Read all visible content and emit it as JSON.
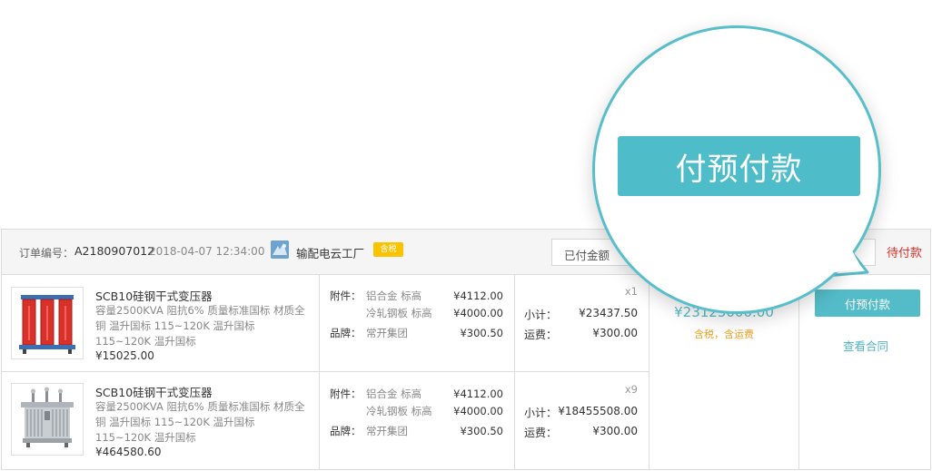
{
  "header": {
    "order_no_label": "订单编号：",
    "order_no": "A2180907012",
    "order_time": "2018-04-07 12:34:00",
    "shop_name": "输配电云工厂",
    "tax_badge": "含税",
    "paid_amount_label": "已付金额",
    "status": "待付款"
  },
  "items": [
    {
      "name": "SCB10硅钢干式变压器",
      "spec": "容量2500KVA  阻抗6%  质量标准国标  材质全铜  温升国标  115~120K  温升国标 115~120K 温升国标",
      "unit_price": "¥15025.00",
      "accessory_label": "附件：",
      "accessories": [
        {
          "name": "铝合金 标高",
          "price": "¥4112.00"
        },
        {
          "name": "冷轧钢板 标高",
          "price": "¥4000.00"
        }
      ],
      "brand_label": "品牌：",
      "brand": "常开集团",
      "brand_price": "¥300.50",
      "qty": "x1",
      "subtotal_label": "小计：",
      "subtotal": "¥23437.50",
      "freight_label": "运费：",
      "freight": "¥300.00",
      "thumb": "red-transformer-image"
    },
    {
      "name": "SCB10硅钢干式变压器",
      "spec": "容量2500KVA  阻抗6%  质量标准国标  材质全铜  温升国标  115~120K  温升国标 115~120K 温升国标",
      "unit_price": "¥464580.60",
      "accessory_label": "附件：",
      "accessories": [
        {
          "name": "铝合金 标高",
          "price": "¥4112.00"
        },
        {
          "name": "冷轧钢板 标高",
          "price": "¥4000.00"
        }
      ],
      "brand_label": "品牌：",
      "brand": "常开集团",
      "brand_price": "¥300.50",
      "qty": "x9",
      "subtotal_label": "小计：",
      "subtotal": "¥18455508.00",
      "freight_label": "运费：",
      "freight": "¥300.00",
      "thumb": "oil-transformer-image"
    }
  ],
  "total": {
    "amount": "¥23125000.00",
    "note": "含税，含运费"
  },
  "actions": {
    "pay_button": "付预付款",
    "view_contract": "查看合同"
  },
  "magnifier": {
    "pay_button": "付预付款"
  },
  "colors": {
    "accent": "#4fbcca",
    "status_red": "#e0302a",
    "badge_yellow": "#f9c300",
    "note_orange": "#f0a020"
  }
}
